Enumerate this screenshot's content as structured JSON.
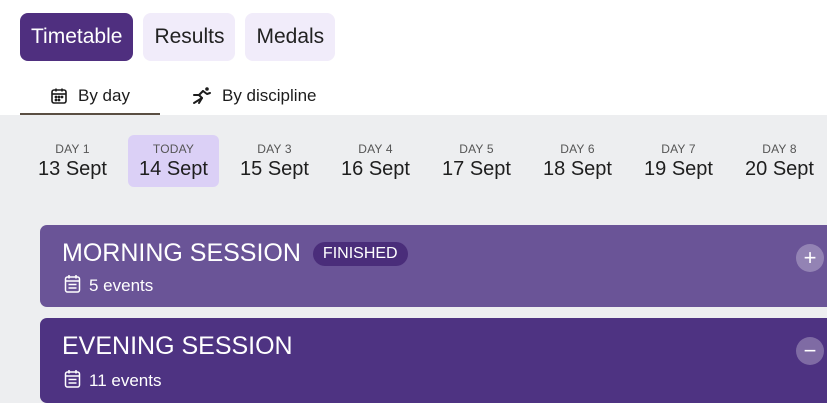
{
  "top_tabs": [
    {
      "label": "Timetable",
      "active": true
    },
    {
      "label": "Results",
      "active": false
    },
    {
      "label": "Medals",
      "active": false
    }
  ],
  "view_tabs": [
    {
      "label": "By day",
      "icon": "calendar-icon",
      "active": true
    },
    {
      "label": "By discipline",
      "icon": "runner-icon",
      "active": false
    }
  ],
  "days": [
    {
      "label": "DAY 1",
      "date": "13 Sept"
    },
    {
      "label": "TODAY",
      "date": "14 Sept",
      "selected": true
    },
    {
      "label": "DAY 3",
      "date": "15 Sept"
    },
    {
      "label": "DAY 4",
      "date": "16 Sept"
    },
    {
      "label": "DAY 5",
      "date": "17 Sept"
    },
    {
      "label": "DAY 6",
      "date": "18 Sept"
    },
    {
      "label": "DAY 7",
      "date": "19 Sept"
    },
    {
      "label": "DAY 8",
      "date": "20 Sept"
    }
  ],
  "sessions": [
    {
      "title": "MORNING SESSION",
      "badge": "FINISHED",
      "events": "5 events",
      "toggle": "+",
      "expanded": false
    },
    {
      "title": "EVENING SESSION",
      "events": "11 events",
      "toggle": "−",
      "expanded": true
    }
  ],
  "colors": {
    "accent": "#4f2f7f",
    "today": "#dbd0f6",
    "morning": "#6a5497",
    "evening": "#4e3382"
  }
}
